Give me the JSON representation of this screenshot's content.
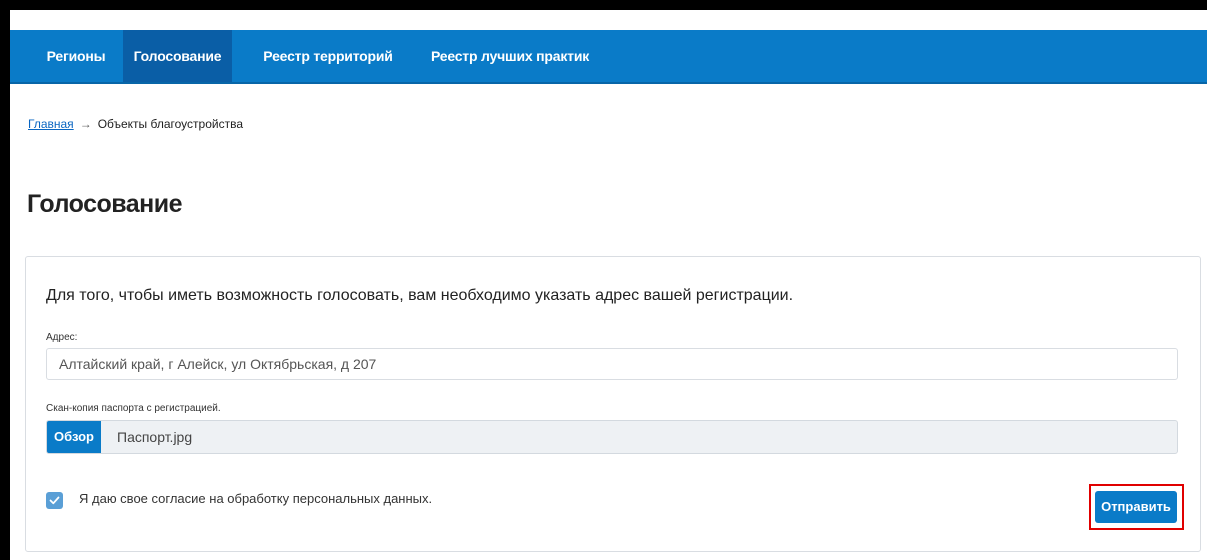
{
  "nav": {
    "items": [
      {
        "label": "Регионы",
        "active": false
      },
      {
        "label": "Голосование",
        "active": true
      },
      {
        "label": "Реестр территорий",
        "active": false
      },
      {
        "label": "Реестр лучших практик",
        "active": false
      }
    ]
  },
  "breadcrumb": {
    "home": "Главная",
    "separator": "→",
    "current": "Объекты благоустройства"
  },
  "page": {
    "title": "Голосование"
  },
  "form": {
    "intro": "Для того, чтобы иметь возможность голосовать, вам необходимо указать адрес вашей регистрации.",
    "address_label": "Адрес:",
    "address_value": "Алтайский край, г Алейск, ул Октябрьская, д 207",
    "passport_label": "Скан-копия паспорта с регистрацией.",
    "browse_label": "Обзор",
    "file_name": "Паспорт.jpg",
    "consent_checked": true,
    "consent_text": "Я даю свое согласие на обработку персональных данных.",
    "submit_label": "Отправить"
  },
  "colors": {
    "nav_bg": "#0a7bc8",
    "nav_active": "#0a5ea6",
    "button": "#0a7bc8",
    "highlight": "#e00000"
  }
}
